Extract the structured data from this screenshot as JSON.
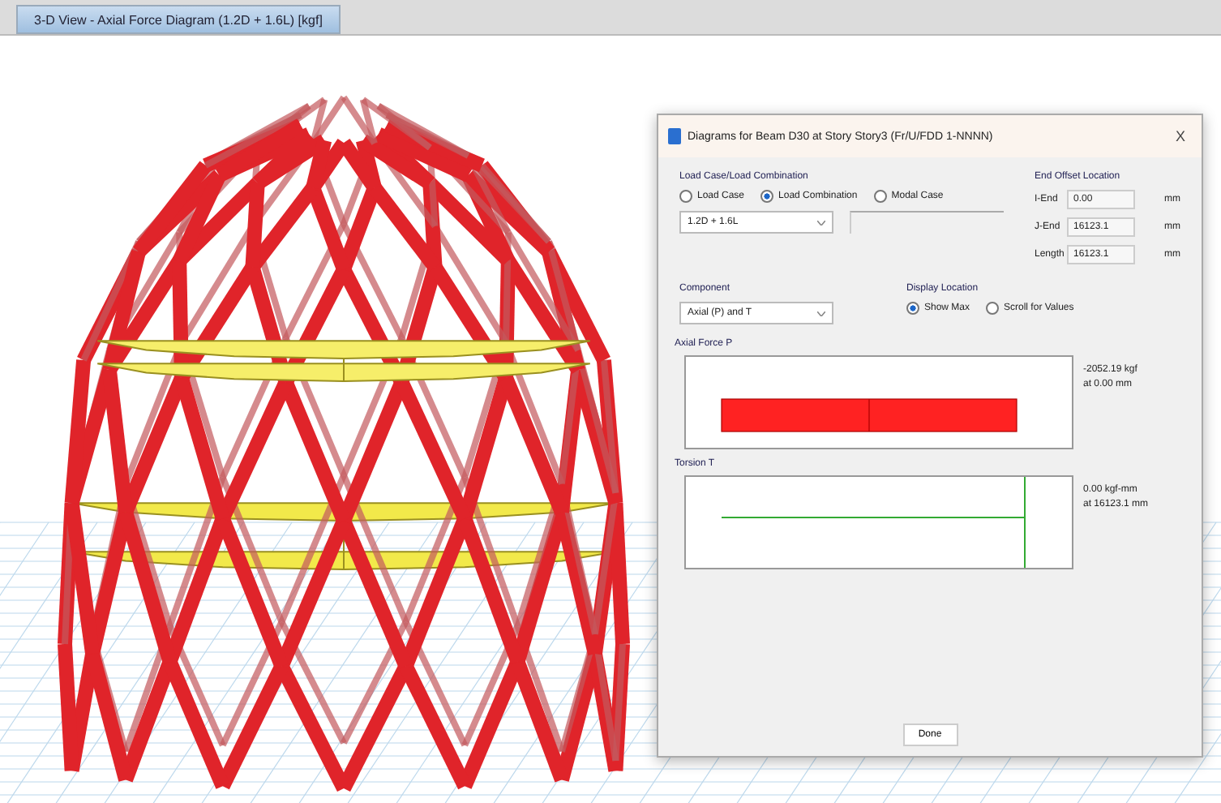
{
  "tab": {
    "label": "3-D View - Axial Force Diagram (1.2D + 1.6L) [kgf]",
    "selected": true
  },
  "dialog": {
    "title": "Diagrams for Beam D30 at Story Story3 (Fr/U/FDD 1-NNNN)",
    "close": "X",
    "load_group": {
      "title": "Load Case/Load Combination",
      "options": [
        {
          "label": "Load Case",
          "selected": false
        },
        {
          "label": "Load Combination",
          "selected": true
        },
        {
          "label": "Modal Case",
          "selected": false
        }
      ],
      "combo": "1.2D + 1.6L"
    },
    "offset_group": {
      "title": "End Offset Location",
      "rows": [
        {
          "label": "I-End",
          "value": "0.00",
          "unit": "mm"
        },
        {
          "label": "J-End",
          "value": "16123.1",
          "unit": "mm"
        },
        {
          "label": "Length",
          "value": "16123.1",
          "unit": "mm"
        }
      ]
    },
    "component": {
      "title": "Component",
      "value": "Axial (P) and T"
    },
    "display": {
      "title": "Display Location",
      "options": [
        {
          "label": "Show Max",
          "selected": true
        },
        {
          "label": "Scroll for Values",
          "selected": false
        }
      ]
    },
    "diagrams": [
      {
        "kind": "bar",
        "title": "Axial Force P",
        "reading": "-2052.19 kgf",
        "location": "at 0.00 mm"
      },
      {
        "kind": "line",
        "title": "Torsion T",
        "reading": "0.00 kgf-mm",
        "location": "at 16123.1 mm"
      }
    ],
    "button": "Done"
  }
}
